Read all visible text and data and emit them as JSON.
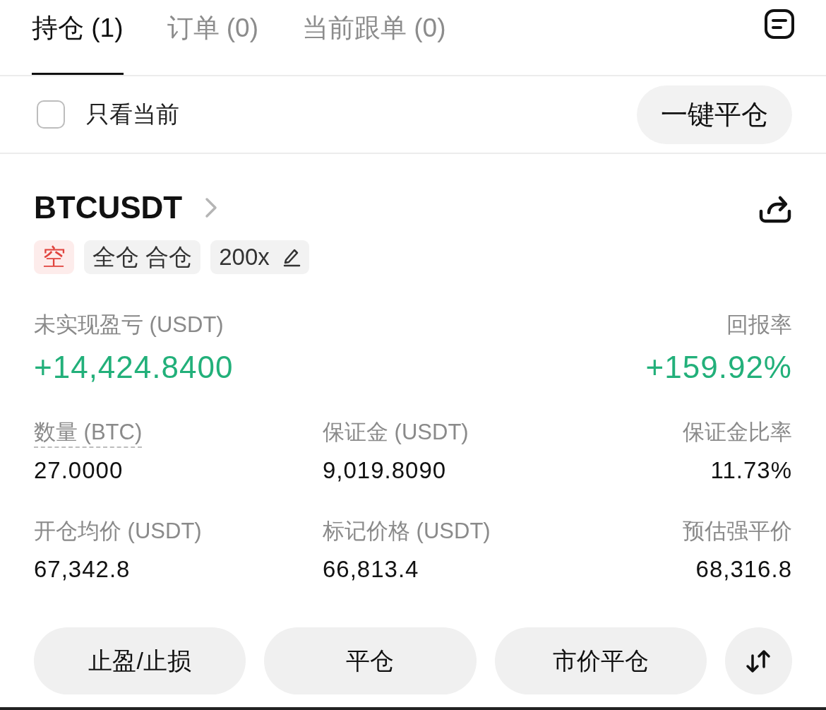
{
  "tabs": [
    {
      "label": "持仓 (1)",
      "selected": true
    },
    {
      "label": "订单 (0)",
      "selected": false
    },
    {
      "label": "当前跟单 (0)",
      "selected": false
    }
  ],
  "filter": {
    "label": "只看当前",
    "checked": false
  },
  "close_all_button": "一键平仓",
  "position": {
    "symbol": "BTCUSDT",
    "tags": [
      {
        "kind": "side",
        "label": "空",
        "editable": false
      },
      {
        "kind": "mode",
        "label": "全仓 合仓",
        "editable": false
      },
      {
        "kind": "mode",
        "label": "200x",
        "editable": true
      }
    ],
    "pnl": {
      "label": "未实现盈亏 (USDT)",
      "value": "+14,424.8400"
    },
    "roe": {
      "label": "回报率",
      "value": "+159.92%"
    },
    "stats": [
      {
        "label": "数量 (BTC)",
        "value": "27.0000",
        "dashed_underline": true
      },
      {
        "label": "保证金 (USDT)",
        "value": "9,019.8090",
        "dashed_underline": false
      },
      {
        "label": "保证金比率",
        "value": "11.73%",
        "dashed_underline": false
      },
      {
        "label": "开仓均价 (USDT)",
        "value": "67,342.8",
        "dashed_underline": false
      },
      {
        "label": "标记价格 (USDT)",
        "value": "66,813.4",
        "dashed_underline": false
      },
      {
        "label": "预估强平价",
        "value": "68,316.8",
        "dashed_underline": false
      }
    ]
  },
  "actions": [
    {
      "kind": "text",
      "label": "止盈/止损"
    },
    {
      "kind": "text",
      "label": "平仓"
    },
    {
      "kind": "text",
      "label": "市价平仓"
    },
    {
      "kind": "swap"
    }
  ]
}
